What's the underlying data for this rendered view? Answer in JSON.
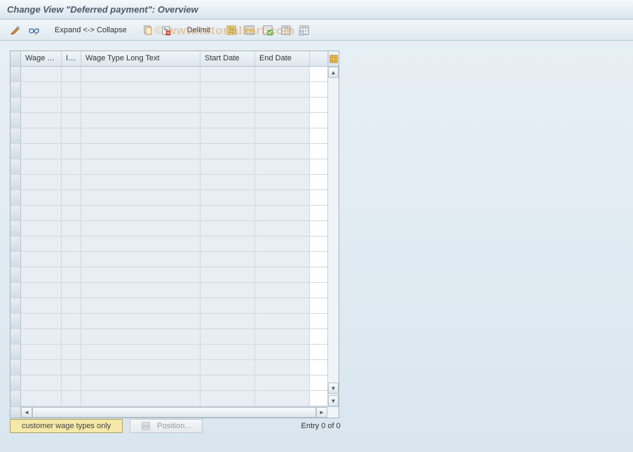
{
  "header": {
    "title": "Change View \"Deferred payment\": Overview"
  },
  "toolbar": {
    "expand_collapse": "Expand <-> Collapse",
    "delimit": "Delimit"
  },
  "table": {
    "columns": {
      "wage_type": "Wage Ty...",
      "inf": "Inf...",
      "long_text": "Wage Type Long Text",
      "start_date": "Start Date",
      "end_date": "End Date"
    },
    "row_count": 22
  },
  "footer": {
    "customer_btn": "customer wage types only",
    "position_btn": "Position...",
    "entry_text": "Entry 0 of 0"
  },
  "watermark": "© www.tutorialkart.com",
  "icons": {
    "pencil_glasses": "pencil-glasses-icon",
    "glasses": "glasses-icon",
    "copy": "copy-icon",
    "delete": "delete-icon",
    "select_all": "select-all-icon",
    "deselect": "deselect-all-icon",
    "config": "table-config-icon"
  }
}
